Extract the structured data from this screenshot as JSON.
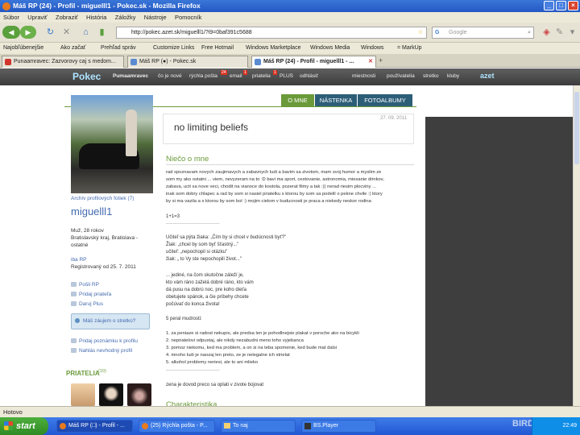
{
  "window": {
    "title": "Máš RP (24) - Profil - miguelll1 - Pokec.sk - Mozilla Firefox",
    "controls": [
      "_",
      "□",
      "×"
    ]
  },
  "menu": [
    "Súbor",
    "Upraviť",
    "Zobraziť",
    "História",
    "Záložky",
    "Nástroje",
    "Pomocník"
  ],
  "nav": {
    "url": "http://pokec.azet.sk/miguelll1/?i9=0baf391c5688",
    "search_placeholder": "Google"
  },
  "bookmarks": [
    "Najobľúbenejšie",
    "Ako začať",
    "Prehľad správ",
    "Customize Links",
    "Free Hotmail",
    "Windows Marketplace",
    "Windows Media",
    "Windows",
    "= MarkUp"
  ],
  "tabs": [
    {
      "label": "Punaamravec: Zazvorovy caj s medom...",
      "fav_color": "#d0342c"
    },
    {
      "label": "Máš RP (●) - Pokec.sk",
      "fav_color": "#5a8ad0"
    },
    {
      "label": "Máš RP (24) - Profil - miguelll1 - ...",
      "fav_color": "#5a8ad0"
    }
  ],
  "pokec": {
    "logo": "Pokec",
    "links": [
      "Pumaamravec",
      "čo je nové",
      "rýchla pošta",
      "email",
      "priatelia",
      "PLUS",
      "odhlásiť"
    ],
    "badges": [
      "24",
      "1",
      "1"
    ],
    "right_links": [
      "miestnosti",
      "používatelia",
      "stretko",
      "kluby"
    ],
    "azet": "azet"
  },
  "profile_tabs": [
    "O MNE",
    "NÁSTENKA",
    "FOTOALBUMY"
  ],
  "sidebar": {
    "archive_link": "Archív profilových fotiek (7)",
    "username": "miguelll1",
    "info_lines": [
      "Muž, 28 rokov",
      "Bratislavský kraj, Bratislava -",
      "ostatné"
    ],
    "plus_link": "iba RP",
    "registered": "Registrovaný od 25. 7. 2011",
    "actions": [
      "Pošli RP",
      "Pridaj priateľa",
      "Daruj Plus"
    ],
    "interest_box": "Máš záujem o stretko?",
    "note_link": "Pridaj poznámku k profilu",
    "report_link": "Nahlás nevhodný profil",
    "friends_heading": "PRIATELIA",
    "friends_count": "(10)"
  },
  "main": {
    "date": "27. 09. 2011",
    "status": "no limiting beliefs",
    "section_heading": "Niečo o mne",
    "about_lines": [
      "rad spoznavam novych zaujimavych a zabavnych ludi a bavim sa zivotom, mam svoj humor a myslim ze",
      "som my ako ostatni ... viem, nevyzeram na to :D bavi ma sport, cestovanie, astronomia, miesanie drinkov,",
      "zabava, ucit sa nove veci, chodit na vianoce do kostola, pozerat filmy a tak :)) nerad riesim plocviny ...",
      "inak som dobry chlapec a rad by som si nasiel priatelku s ktorou by som sa podelil o pekne chvile :) ktory",
      "by si ma vazila a s ktorou by som bol :) mojim cielom v buducnosti je praca a niekedy neskor rodina"
    ],
    "equation": "1+1=3",
    "divider1": "----------------------------------------",
    "dialog_lines": [
      "Učiteľ sa pýta žiaka: „Čím by si chcel v budúcnosti byť?\"",
      "Žiak: „chcel by som byť šťastný...\"",
      "učiteľ: „nepochopil si otázku\"",
      "žiak: „ to Vy ste nepochopili život...\""
    ],
    "quote_lines": [
      "... jediné, na čom skutočne záleží je,",
      "kto vám ráno zaželá dobré ráno, kto vám",
      "dá pusu na dobrú noc, pre koho dieťa",
      "obetujete spánok, a čie príbehy chcete",
      "počúvať do konca života!"
    ],
    "wisdom_heading": "5 peral mudrosti:",
    "wisdom_lines": [
      "1. za peniaze si radost nekupis, ale predsa len je pohodlnejsie plakat v porsche ako na bicykli",
      "2. nepriatelovi odpustaj, ale nikdy nezabudni meno toho vyjebanca",
      "3. pomoz niekomu, ked ma problem, a on si na teba spomenie, ked bude mat dalsi",
      "4. mnoho ludi je naozaj len preto, ze je nelegalne ich strielat",
      "5. alkohol problemy neriesi, ale to ani mlieko"
    ],
    "divider2": "----------------------------------------",
    "closing": "zena je dovod preco sa oplati v zivote bojovat",
    "next_heading": "Charakteristika"
  },
  "statusbar": "Hotovo",
  "taskbar": {
    "start": "start",
    "tasks": [
      "Máš RP (□) - Profil - ...",
      "(25) Rýchla pošta - P...",
      "To naj",
      "BS.Player"
    ],
    "clock": "22:49",
    "watermark": "BIRDZ"
  }
}
